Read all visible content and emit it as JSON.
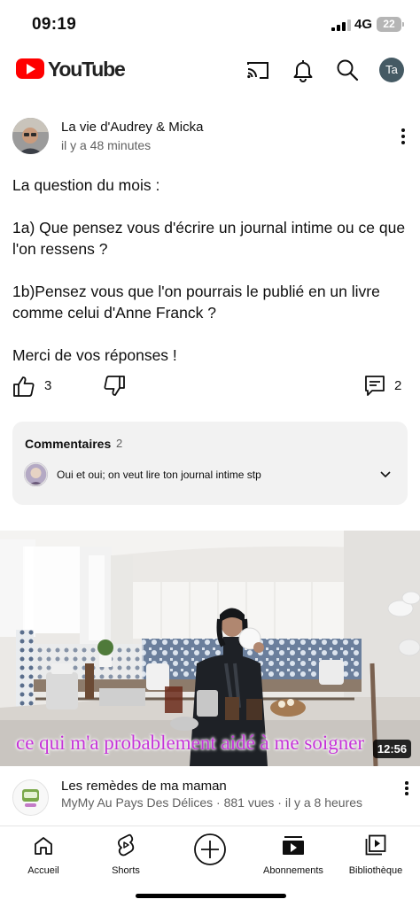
{
  "status_bar": {
    "time": "09:19",
    "network": "4G",
    "battery": "22"
  },
  "header": {
    "logo_text": "YouTube",
    "icons": [
      "cast-icon",
      "bell-icon",
      "search-icon"
    ],
    "account_initials": "Ta",
    "brand_color": "#FF0000"
  },
  "post": {
    "author": "La vie d'Audrey & Micka",
    "time": "il y a 48 minutes",
    "paragraphs": [
      "La question du mois :",
      "1a) Que pensez vous d'écrire un journal intime ou ce que l'on ressens ?",
      "1b)Pensez vous que l'on pourrais le publié en un livre comme celui d'Anne Franck ?",
      "Merci de vos réponses !"
    ],
    "likes": "3",
    "comments": "2"
  },
  "comments_box": {
    "title": "Commentaires",
    "count": "2",
    "first_comment": "Oui et oui; on veut lire ton journal intime stp"
  },
  "video": {
    "caption": "ce qui m'a probablement aidé à me soigner",
    "duration": "12:56",
    "title": "Les remèdes de ma maman",
    "meta": "MyMy Au Pays Des Délices · 881 vues · il y a 8 heures",
    "caption_color": "#C533D8"
  },
  "bottom_nav": {
    "home": "Accueil",
    "shorts": "Shorts",
    "subscriptions": "Abonnements",
    "library": "Bibliothèque"
  }
}
